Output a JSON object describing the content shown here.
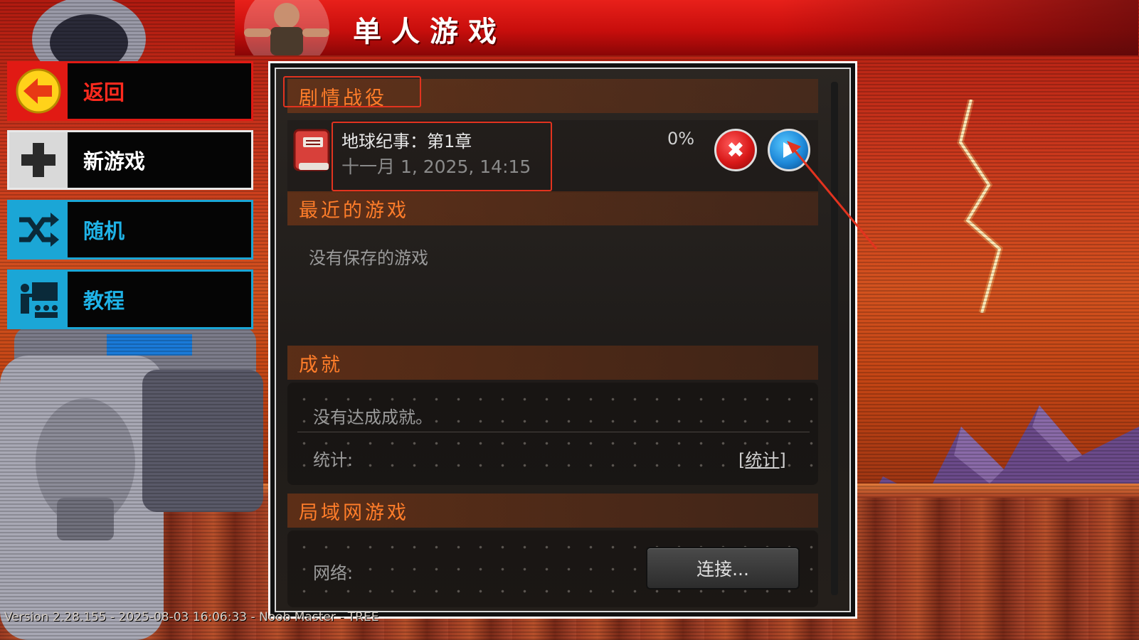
{
  "title": "单人游戏",
  "menu": {
    "back": "返回",
    "new_game": "新游戏",
    "random": "随机",
    "tutorial": "教程"
  },
  "campaign": {
    "header": "剧情战役",
    "save": {
      "name": "地球纪事：第1章",
      "date": "十一月 1, 2025, 14:15",
      "progress": "0%"
    }
  },
  "recent": {
    "header": "最近的游戏",
    "empty": "没有保存的游戏"
  },
  "achievements": {
    "header": "成就",
    "empty": "没有达成成就。",
    "stats_label": "统计:",
    "stats_link": "[统计]"
  },
  "lan": {
    "header": "局域网游戏",
    "network_label": "网络:",
    "connect": "连接..."
  },
  "version": "Version 2.28.155 - 2025-08-03 16:06:33 - Noob Master - TREE",
  "colors": {
    "accent_orange": "#ff7d2a",
    "back_red": "#e11a14",
    "blue": "#1ba6d6",
    "annotation_red": "#e2331f"
  }
}
